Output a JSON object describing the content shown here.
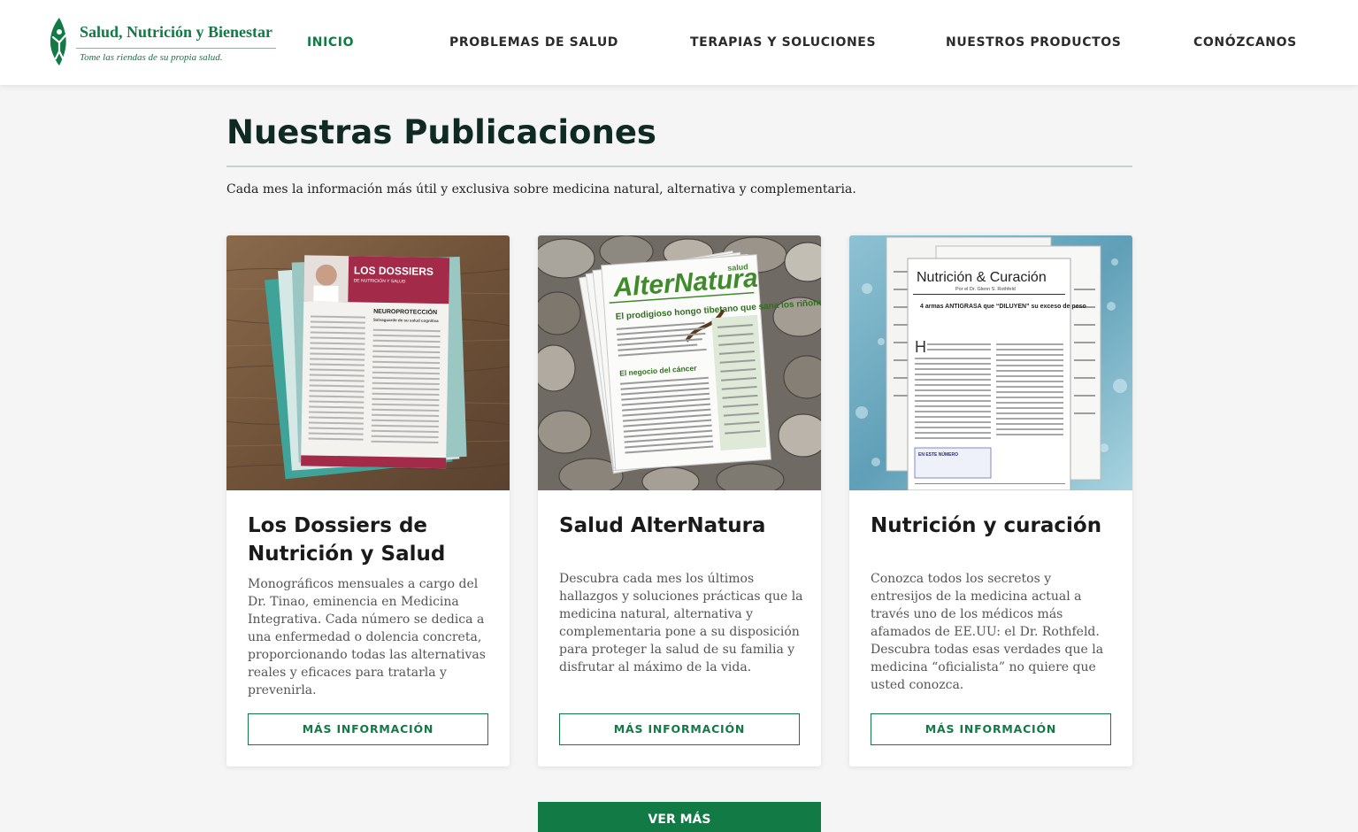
{
  "brand": {
    "title": "Salud, Nutrición y Bienestar",
    "tagline": "Tome las riendas de su propia salud."
  },
  "nav": [
    "INICIO",
    "PROBLEMAS DE SALUD",
    "TERAPIAS Y SOLUCIONES",
    "NUESTROS PRODUCTOS",
    "CONÓZCANOS"
  ],
  "page": {
    "title": "Nuestras Publicaciones",
    "intro": "Cada mes la información más útil y exclusiva sobre medicina natural, alternativa y complementaria."
  },
  "cards": [
    {
      "title": "Los Dossiers de Nutrición y Salud",
      "description": "Monográficos mensuales a cargo del Dr. Tinao, eminencia en Medicina Integrativa. Cada número se dedica a una enfermedad o dolencia concreta, proporcionando todas las alternativas reales y eficaces para tratarla y prevenirla.",
      "button": "MÁS INFORMACIÓN",
      "cover": {
        "masthead": "LOS DOSSIERS",
        "subhead": "DE NUTRICIÓN Y SALUD",
        "headline": "NEUROPROTECCIÓN",
        "kicker": "Salvaguarde de su salud cognitiva"
      }
    },
    {
      "title": "Salud AlterNatura",
      "description": "Descubra cada mes los últimos hallazgos y soluciones prácticas que la medicina natural, alternativa y complementaria pone a su disposición para proteger la salud de su familia y disfrutar al máximo de la vida.",
      "button": "MÁS INFORMACIÓN",
      "cover": {
        "masthead": "AlterNatura",
        "badge": "salud",
        "headline": "El prodigioso hongo tibetano que sana los riñones",
        "kicker": "El negocio del cáncer"
      }
    },
    {
      "title": "Nutrición y curación",
      "description": "Conozca todos los secretos y entresijos de la medicina actual a través uno de los médicos más afamados de EE.UU: el Dr. Rothfeld. Descubra todas esas verdades que la medicina “oficialista” no quiere que usted conozca.",
      "button": "MÁS INFORMACIÓN",
      "cover": {
        "masthead": "Nutrición & Curación",
        "byline": "Por el Dr. Glenn S. Rothfeld",
        "headline": "4 armas ANTIGRASA que “DILUYEN” su exceso de peso",
        "box": "EN ESTE NÚMERO"
      }
    }
  ],
  "more_button": "VER MÁS",
  "colors": {
    "brand_green": "#117a45",
    "title_dark": "#0f2a22",
    "dossier_red": "#a32a48"
  }
}
